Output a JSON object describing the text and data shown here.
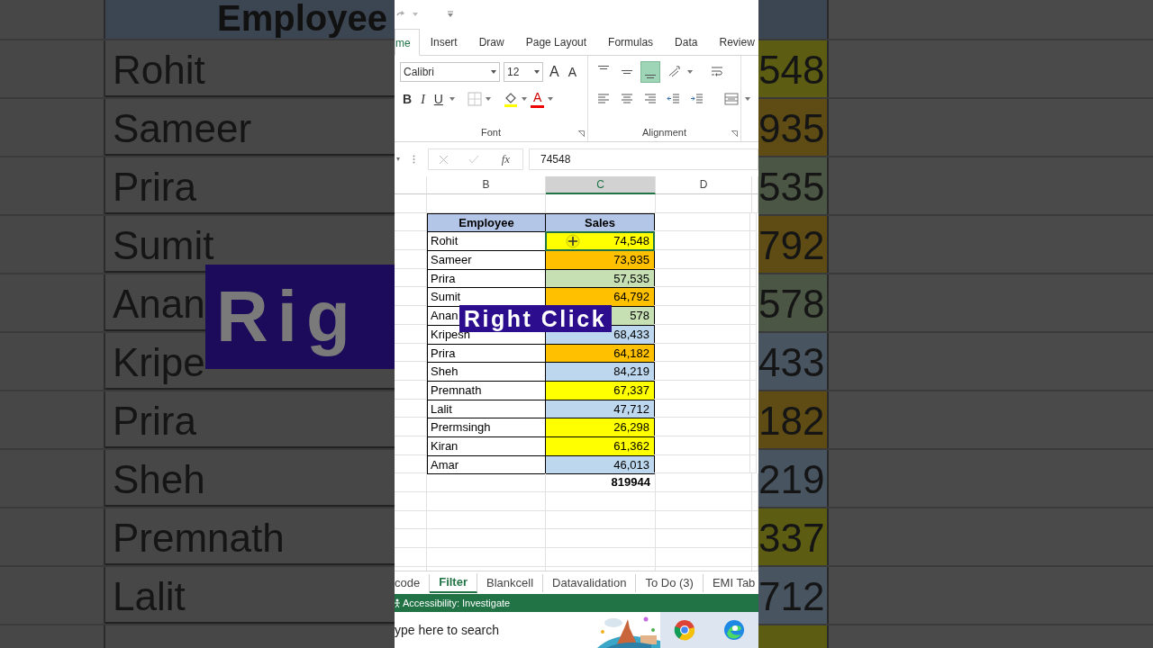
{
  "backdrop_left": {
    "header": "Employee",
    "names": [
      "Rohit",
      "Sameer",
      "Prira",
      "Sumit",
      "Anan",
      "Kripe",
      "Prira",
      "Sheh",
      "Premnath",
      "Lalit"
    ]
  },
  "backdrop_overlay": {
    "text": "Rig"
  },
  "backdrop_right": {
    "values": [
      {
        "text": "548",
        "color": "#5c5c12"
      },
      {
        "text": "935",
        "color": "#5e4c14"
      },
      {
        "text": "535",
        "color": "#4c5644"
      },
      {
        "text": "792",
        "color": "#5e4c14"
      },
      {
        "text": "578",
        "color": "#4c5644"
      },
      {
        "text": "433",
        "color": "#485460"
      },
      {
        "text": "182",
        "color": "#5e4c14"
      },
      {
        "text": "219",
        "color": "#485460"
      },
      {
        "text": "337",
        "color": "#5c5c12"
      },
      {
        "text": "712",
        "color": "#485460"
      }
    ]
  },
  "ribbon_tabs": [
    {
      "label": "me",
      "selected": true
    },
    {
      "label": "Insert",
      "selected": false
    },
    {
      "label": "Draw",
      "selected": false
    },
    {
      "label": "Page Layout",
      "selected": false
    },
    {
      "label": "Formulas",
      "selected": false
    },
    {
      "label": "Data",
      "selected": false
    },
    {
      "label": "Review",
      "selected": false
    }
  ],
  "font_group": {
    "font": "Calibri",
    "size": "12",
    "label": "Font",
    "buttons": [
      {
        "kind": "grow",
        "label": "A"
      },
      {
        "kind": "shrink",
        "label": "A"
      },
      {
        "kind": "bold",
        "label": "B"
      },
      {
        "kind": "italic",
        "label": "I"
      },
      {
        "kind": "underline",
        "label": "U"
      },
      {
        "kind": "borders"
      },
      {
        "kind": "fill"
      },
      {
        "kind": "color",
        "label": "A"
      }
    ]
  },
  "alignment_group": {
    "label": "Alignment",
    "buttons": [
      {
        "kind": "top",
        "selected": false
      },
      {
        "kind": "middle",
        "selected": false
      },
      {
        "kind": "bottom",
        "selected": true
      },
      {
        "kind": "orientation",
        "selected": false
      },
      {
        "kind": "wrap",
        "selected": false
      },
      {
        "kind": "left",
        "selected": false
      },
      {
        "kind": "center",
        "selected": false
      },
      {
        "kind": "right",
        "selected": false
      },
      {
        "kind": "outdent",
        "selected": false
      },
      {
        "kind": "indent",
        "selected": false
      },
      {
        "kind": "merge",
        "selected": false
      }
    ]
  },
  "formula_bar": {
    "fx": "fx",
    "value": "74548"
  },
  "columns": [
    {
      "label": "B",
      "selected": false
    },
    {
      "label": "C",
      "selected": true
    },
    {
      "label": "D",
      "selected": false
    }
  ],
  "table": {
    "headers": [
      "Employee",
      "Sales"
    ],
    "total": "819944",
    "rows": [
      {
        "name": "Rohit",
        "sales": "74,548",
        "color": "#ffff00",
        "selected": true
      },
      {
        "name": "Sameer",
        "sales": "73,935",
        "color": "#ffc000",
        "selected": false
      },
      {
        "name": "Prira",
        "sales": "57,535",
        "color": "#c6e0b4",
        "selected": false
      },
      {
        "name": "Sumit",
        "sales": "64,792",
        "color": "#ffc000",
        "selected": false
      },
      {
        "name": "Anan",
        "sales": "578",
        "color": "#c6e0b4",
        "selected": false
      },
      {
        "name": "Kripesh",
        "sales": "68,433",
        "color": "#bdd7ee",
        "selected": false
      },
      {
        "name": "Prira",
        "sales": "64,182",
        "color": "#ffc000",
        "selected": false
      },
      {
        "name": "Sheh",
        "sales": "84,219",
        "color": "#bdd7ee",
        "selected": false
      },
      {
        "name": "Premnath",
        "sales": "67,337",
        "color": "#ffff00",
        "selected": false
      },
      {
        "name": "Lalit",
        "sales": "47,712",
        "color": "#bdd7ee",
        "selected": false
      },
      {
        "name": "Prermsingh",
        "sales": "26,298",
        "color": "#ffff00",
        "selected": false
      },
      {
        "name": "Kiran",
        "sales": "61,362",
        "color": "#ffff00",
        "selected": false
      },
      {
        "name": "Amar",
        "sales": "46,013",
        "color": "#bdd7ee",
        "selected": false
      }
    ]
  },
  "overlay": {
    "text": "Right Click"
  },
  "sheet_tabs": [
    {
      "label": "code",
      "selected": false
    },
    {
      "label": "Filter",
      "selected": true
    },
    {
      "label": "Blankcell",
      "selected": false
    },
    {
      "label": "Datavalidation",
      "selected": false
    },
    {
      "label": "To Do  (3)",
      "selected": false
    },
    {
      "label": "EMI Tab",
      "selected": false
    }
  ],
  "status_bar": {
    "text": "Accessibility: Investigate"
  },
  "taskbar": {
    "placeholder": "ype here to search"
  }
}
